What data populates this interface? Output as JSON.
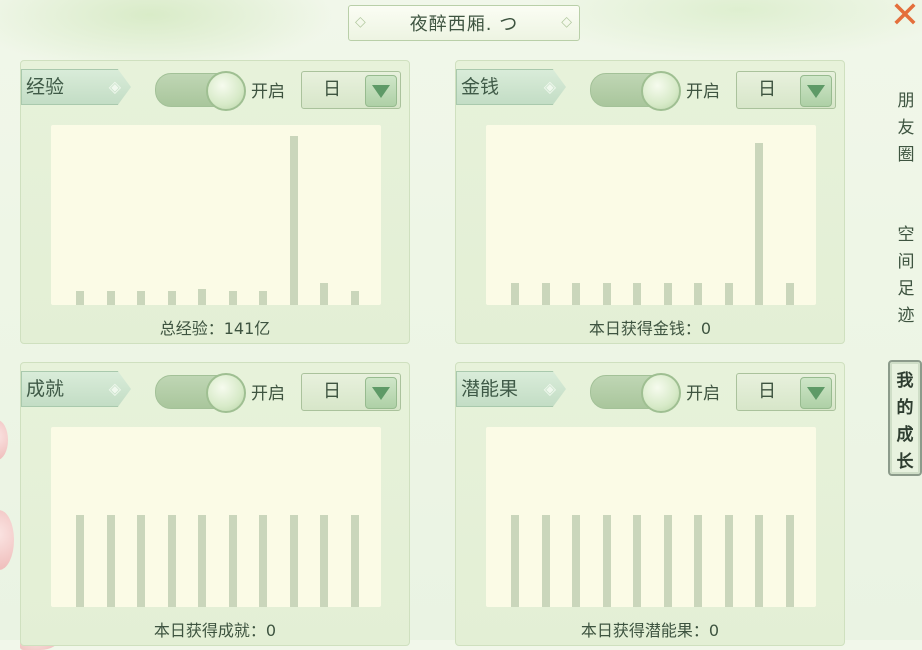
{
  "title": "夜醉西厢. つ",
  "panels": [
    {
      "name": "经验",
      "toggle_label": "开启",
      "period": "日",
      "caption": "总经验：141亿",
      "bars": [
        0.08,
        0.08,
        0.08,
        0.08,
        0.09,
        0.08,
        0.08,
        0.94,
        0.12,
        0.08
      ]
    },
    {
      "name": "金钱",
      "toggle_label": "开启",
      "period": "日",
      "caption": "本日获得金钱：0",
      "bars": [
        0.12,
        0.12,
        0.12,
        0.12,
        0.12,
        0.12,
        0.12,
        0.12,
        0.9,
        0.12
      ]
    },
    {
      "name": "成就",
      "toggle_label": "开启",
      "period": "日",
      "caption": "本日获得成就：0",
      "bars": [
        0.51,
        0.51,
        0.51,
        0.51,
        0.51,
        0.51,
        0.51,
        0.51,
        0.51,
        0.51
      ]
    },
    {
      "name": "潜能果",
      "toggle_label": "开启",
      "period": "日",
      "caption": "本日获得潜能果：0",
      "bars": [
        0.51,
        0.51,
        0.51,
        0.51,
        0.51,
        0.51,
        0.51,
        0.51,
        0.51,
        0.51
      ]
    }
  ],
  "side_tabs": [
    {
      "label": "朋友圈",
      "active": false
    },
    {
      "label": "空间足迹",
      "active": false
    },
    {
      "label": "我的成长",
      "active": true
    }
  ],
  "colors": {
    "close": "#e46f3c",
    "bar": "#cad6bb",
    "chart_bg": "#fbfbe6"
  }
}
